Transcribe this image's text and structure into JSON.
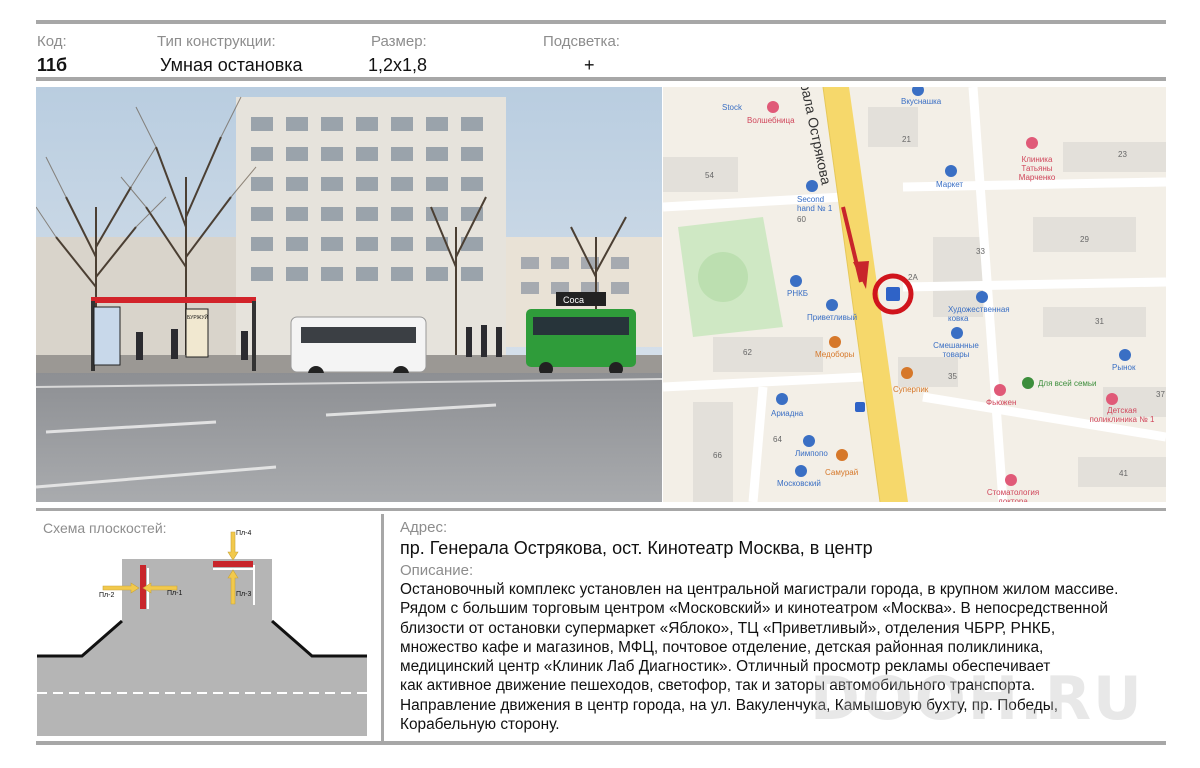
{
  "header": {
    "code_label": "Код:",
    "code_value": "11б",
    "type_label": "Тип конструкции:",
    "type_value": "Умная остановка",
    "size_label": "Размер:",
    "size_value": "1,2x1,8",
    "light_label": "Подсветка:",
    "light_value": "+"
  },
  "photo": {
    "stop_sign": "БУРЖУЙ",
    "shop_sign": "Coca"
  },
  "map": {
    "street": "рала Острякова",
    "labels": [
      {
        "text": "Stock",
        "color": "blue"
      },
      {
        "text": "Волшебница",
        "color": "red"
      },
      {
        "text": "Вкуснашка",
        "color": "blue"
      },
      {
        "text": "Клиника Татьяны Марченко",
        "color": "red"
      },
      {
        "text": "Second hand № 1",
        "color": "blue"
      },
      {
        "text": "Маркет",
        "color": "blue"
      },
      {
        "text": "РНКБ",
        "color": "blue"
      },
      {
        "text": "Приветливый",
        "color": "blue"
      },
      {
        "text": "Художественная ковка",
        "color": "blue"
      },
      {
        "text": "Медоборы",
        "color": "orange"
      },
      {
        "text": "Смешанные товары",
        "color": "blue"
      },
      {
        "text": "Рынок",
        "color": "blue"
      },
      {
        "text": "Суперпик",
        "color": "orange"
      },
      {
        "text": "Для всей семьи",
        "color": "green"
      },
      {
        "text": "Фьюжен",
        "color": "red"
      },
      {
        "text": "Детская поликлиника № 1",
        "color": "red"
      },
      {
        "text": "Ариадна",
        "color": "blue"
      },
      {
        "text": "Лимпопо",
        "color": "blue"
      },
      {
        "text": "Самурай",
        "color": "orange"
      },
      {
        "text": "Московский",
        "color": "blue"
      },
      {
        "text": "Стоматология доктора",
        "color": "red"
      }
    ],
    "numbers": [
      "21",
      "23",
      "54",
      "60",
      "29",
      "33",
      "31",
      "62",
      "35",
      "37",
      "64",
      "66",
      "41",
      "2A"
    ]
  },
  "schema": {
    "title": "Схема плоскостей:",
    "pl1": "Пл-1",
    "pl2": "Пл-2",
    "pl3": "Пл-3",
    "pl4": "Пл-4"
  },
  "address": {
    "label": "Адрес:",
    "value": "пр. Генерала Острякова, ост. Кинотеатр Москва, в центр"
  },
  "description": {
    "label": "Описание:",
    "lines": [
      "Остановочный комплекс установлен на центральной магистрали города, в крупном жилом массиве.",
      "Рядом с большим торговым центром «Московский» и кинотеатром «Москва». В непосредственной",
      "близости от остановки супермаркет «Яблоко», ТЦ «Приветливый», отделения ЧБРР, РНКБ,",
      "множество кафе и магазинов, МФЦ, почтовое отделение, детская районная поликлиника,",
      "медицинский центр «Клиник Лаб Диагностик». Отличный просмотр рекламы обеспечивает",
      "как активное движение пешеходов, светофор, так и заторы автомобильного транспорта.",
      "Направление движения в центр города, на ул. Вакуленчука, Камышовую бухту, пр. Победы,",
      "Корабельную сторону."
    ]
  },
  "watermark": "DOOH.RU",
  "colors": {
    "rule": "#a7a7a7",
    "label_gray": "#8d8d8d",
    "road": "#b5b5b5",
    "arrow_yellow": "#f2c94c",
    "plane_red": "#c8252b",
    "map_road": "#f6d86b",
    "map_circle": "#d0141c"
  }
}
